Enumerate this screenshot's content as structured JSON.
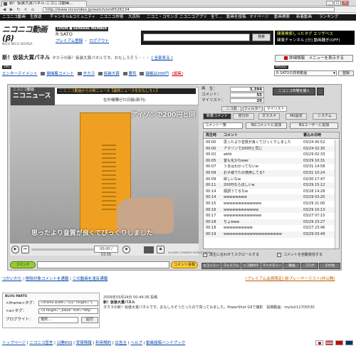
{
  "browser": {
    "tab_title": "新！仮装大賞パネル‐ニコニコ動画...",
    "url": "http://www.nicovideo.jp/watch/sm6526134"
  },
  "topnav": {
    "items": [
      "ニコニコ動画",
      "生放送",
      "チャンネル&コミュニティ",
      "ニコニコ市場",
      "大百科",
      "ニコニ・コモンズ",
      "ニコニコアプリ",
      "全て..."
    ],
    "right_items": [
      "動画を投稿",
      "マイページ",
      "動画検索",
      "新着動画",
      "ランキング"
    ]
  },
  "header": {
    "logo_main": "ニコニコ動画(β)",
    "logo_sub": "NICO NICO DOUGA",
    "login_badge": "LOGIN ■ GENERAL MEMBER",
    "user_name": "R SATO",
    "link_premium": "プレミアム登録",
    "link_logout": "ログアウト",
    "search_button": "検索",
    "ad_line1": "関東検索しったタグ エリザベス",
    "ad_line2": "関東チャンネル [分] 動画騒ぎ(OFF)",
    "ad_right": "背面表示 リセット"
  },
  "video": {
    "title": "新！仮装大賞パネル",
    "desc": "タカラの新！仮装大賞パネルです。おもしろそう・・・",
    "more": "[ 全部見る ]",
    "edit_button": "詳細情報　メニューを表示する"
  },
  "tags": {
    "label": "TAG",
    "items": [
      "エンターテイメント",
      "描描着コメント",
      "タカラ",
      "仮装大賞",
      "悪気",
      "価格は200円"
    ],
    "extra": "[編集]"
  },
  "mylist": {
    "label": "MYLIST",
    "selected": "R SATOの技術動画",
    "button": "登録"
  },
  "player": {
    "channel": "ニコニュース",
    "channel_sub": "ニコニコ動画",
    "ticker": "ニコ ニコ動画からの新ニュース【最新ニュースをおもしろく】",
    "subheader": "在外機購ゼロ日級(新刊)",
    "caption_top": "アイゾンで200円と同",
    "caption_bottom": "思ったより音質が良くてびっくりしました",
    "time": "00:00 / 03:56",
    "ctrl_labels": "VOLUME  COMMENT  REPEAT  WIDE",
    "cmd_button": "コマンド",
    "post_button": "コメント投稿"
  },
  "stats": {
    "views_label": "再　生：",
    "views": "3,394",
    "comments_label": "コメント：",
    "comments": "55",
    "mylist_label": "マイリスト：",
    "mylist": "20",
    "nico_button": "ニコニコ市場を開く"
  },
  "tabs1": [
    "ニコ割",
    "フィルター",
    "マイリスト"
  ],
  "tabs2": [
    "新着コメント",
    "自分の",
    "オススメ",
    "NG設定",
    "システム"
  ],
  "comment_ctrl": {
    "select": "コメント一覧",
    "ng_comment": "NGコメントに追加",
    "ng_user": "NGユーザーに追加"
  },
  "comment_table": {
    "headers": [
      "再生時",
      "コメント",
      "書込み日時"
    ],
    "rows": [
      {
        "t": "00:00",
        "c": "思ったより音質が良くてびっくりしました",
        "d": "03/24 00:52"
      },
      {
        "t": "00:00",
        "c": "アマゾンで200円と同じ",
        "d": "03/24 02:30"
      },
      {
        "t": "00:02",
        "c": "wktk",
        "d": "03/29 02:33"
      },
      {
        "t": "00:05",
        "c": "昔も化かなwwr",
        "d": "03/29 10:31"
      },
      {
        "t": "00:07",
        "c": "うまはわかってないw",
        "d": "03/31 14:58"
      },
      {
        "t": "00:09",
        "c": "お子様でたの使用してる？",
        "d": "03/31 10:24"
      },
      {
        "t": "00:09",
        "c": "欲しいなw",
        "d": "03/30 17:47"
      },
      {
        "t": "00:11",
        "c": "200円ならほしいw",
        "d": "03/29 15:12"
      },
      {
        "t": "00:14",
        "c": "順調うてるなw",
        "d": "03/28 14:28"
      },
      {
        "t": "00:14",
        "c": "wwwwwwww",
        "d": "03/29 03:20"
      },
      {
        "t": "00:15",
        "c": "wwwwwwwwwwwww",
        "d": "03/29 21:00"
      },
      {
        "t": "00:16",
        "c": "wwwwwwwwwwww",
        "d": "03/29 10:13"
      },
      {
        "t": "00:17",
        "c": "wwwwwwwwwwwww",
        "d": "03/27 07:15"
      },
      {
        "t": "00:18",
        "c": "ちょwww",
        "d": "03/29 23:27"
      },
      {
        "t": "00:18",
        "c": "wwwwwwwwww",
        "d": "03/27 23:46"
      },
      {
        "t": "00:19",
        "c": "wwwwwwwwwwwwwwwwwwww",
        "d": "03/29 03:49"
      }
    ]
  },
  "checks": {
    "autoscroll": "再生に合わせてスクロールする",
    "write_date": "コメントを自動受信する"
  },
  "bottomtabs": [
    "エコノミー",
    "プレミアム",
    "ニコ割OFF",
    "マイメモリー",
    "動画",
    "ブログ",
    "その他"
  ],
  "under": {
    "link1": "つかいかた",
    "link2": "削除対象コメントを通報",
    "link3": "この動画を違反通報",
    "premium": "[プレミアム会員限定] 新プレーヤーテスト(非公開)"
  },
  "blog": {
    "title": "BLOG PARTS",
    "iframe_label": "<iframe>タグ：",
    "iframe_value": "<iframe width=\"312\" height=\"1",
    "a_label": "<a>タグ：",
    "a_value": "<a target=\"_blank\" href=\"http:",
    "site_label": "ブログサイト：",
    "site_select": "選択...",
    "paste_button": "貼付"
  },
  "info": {
    "date": "2009年03月24日 00:44:36 投稿",
    "title": "新！仮装大賞パネル",
    "desc": "タカラの新！仮装大賞パネルです。おもしろそうだったので買ってみました。PowerShot G9で撮影　投稿動画：mylist/11705530"
  },
  "footer": {
    "links": [
      "トップページ",
      "ニコニコ宣言",
      "公開RSS",
      "受賞情報",
      "利用規約",
      "広告主",
      "ヘルプ",
      "動画投稿ハンドブック"
    ]
  }
}
